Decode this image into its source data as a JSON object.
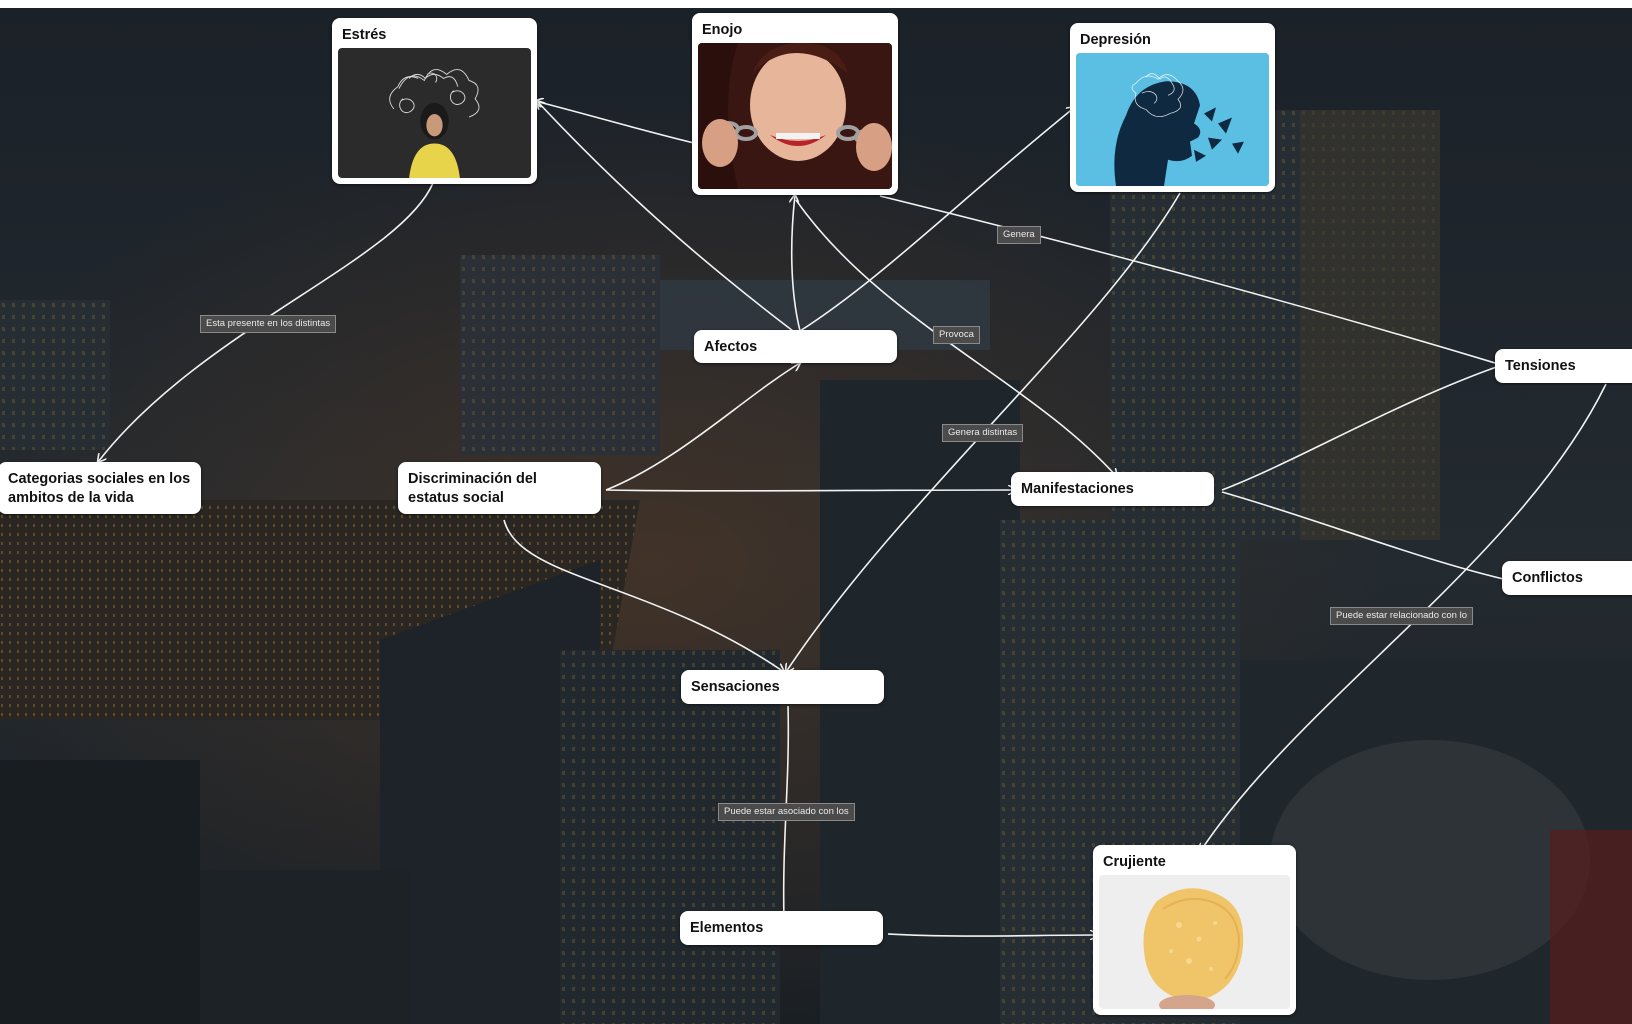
{
  "nodes": {
    "estres": "Estrés",
    "enojo": "Enojo",
    "depresion": "Depresión",
    "afectos": "Afectos",
    "tensiones": "Tensiones",
    "categorias": "Categorias sociales en los ambitos de la vida",
    "discriminacion": "Discriminación del estatus social",
    "manifestaciones": "Manifestaciones",
    "conflictos": "Conflictos",
    "sensaciones": "Sensaciones",
    "elementos": "Elementos",
    "crujiente": "Crujiente"
  },
  "edge_labels": {
    "presente": "Esta presente en los distintas",
    "genera": "Genera",
    "provoca": "Provoca",
    "genera_distintas": "Genera distintas",
    "relacionado": "Puede estar relacionado con lo",
    "asociado": "Puede estar asociado con los"
  },
  "colors": {
    "node_bg": "#ffffff",
    "edge": "#f2f2f2",
    "edge_label_bg": "#4b4b4b",
    "depresion_bg": "#5bbfe3"
  }
}
